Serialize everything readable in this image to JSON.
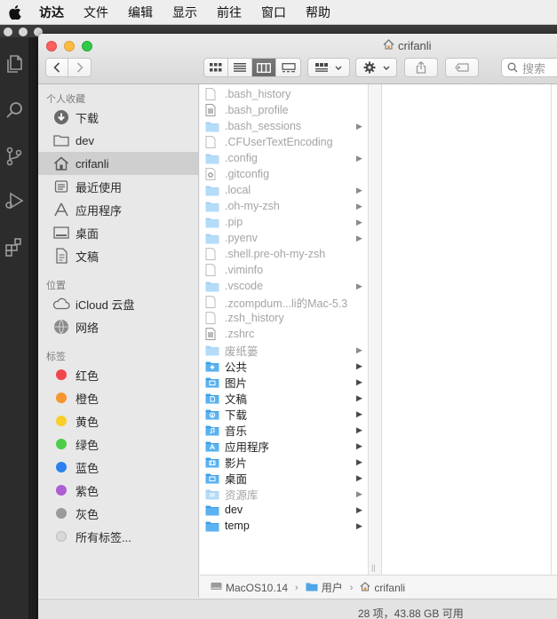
{
  "menubar": {
    "items": [
      "访达",
      "文件",
      "编辑",
      "显示",
      "前往",
      "窗口",
      "帮助"
    ]
  },
  "window": {
    "title": "crifanli"
  },
  "toolbar": {
    "search_placeholder": "搜索"
  },
  "sidebar": {
    "favorites_header": "个人收藏",
    "favorites": [
      {
        "label": "下载",
        "icon": "download-icon"
      },
      {
        "label": "dev",
        "icon": "folder-icon"
      },
      {
        "label": "crifanli",
        "icon": "home-icon",
        "selected": true
      },
      {
        "label": "最近使用",
        "icon": "recents-icon"
      },
      {
        "label": "应用程序",
        "icon": "applications-icon"
      },
      {
        "label": "桌面",
        "icon": "desktop-icon"
      },
      {
        "label": "文稿",
        "icon": "documents-icon"
      }
    ],
    "locations_header": "位置",
    "locations": [
      {
        "label": "iCloud 云盘",
        "icon": "cloud-icon"
      },
      {
        "label": "网络",
        "icon": "network-icon"
      }
    ],
    "tags_header": "标签",
    "tags": [
      {
        "label": "红色",
        "color": "#f1464b"
      },
      {
        "label": "橙色",
        "color": "#f7952e"
      },
      {
        "label": "黄色",
        "color": "#f8cf2b"
      },
      {
        "label": "绿色",
        "color": "#4ccd4a"
      },
      {
        "label": "蓝色",
        "color": "#2b82ee"
      },
      {
        "label": "紫色",
        "color": "#ae5ed3"
      },
      {
        "label": "灰色",
        "color": "#9a9a9a"
      },
      {
        "label": "所有标签...",
        "color": "#d8d8d8"
      }
    ]
  },
  "files": [
    {
      "name": ".bash_history",
      "kind": "doc",
      "hidden": true,
      "folder": false
    },
    {
      "name": ".bash_profile",
      "kind": "text",
      "hidden": true,
      "folder": false
    },
    {
      "name": ".bash_sessions",
      "kind": "folder",
      "hidden": true,
      "folder": true
    },
    {
      "name": ".CFUserTextEncoding",
      "kind": "doc",
      "hidden": true,
      "folder": false
    },
    {
      "name": ".config",
      "kind": "folder",
      "hidden": true,
      "folder": true
    },
    {
      "name": ".gitconfig",
      "kind": "gear",
      "hidden": true,
      "folder": false
    },
    {
      "name": ".local",
      "kind": "folder",
      "hidden": true,
      "folder": true
    },
    {
      "name": ".oh-my-zsh",
      "kind": "folder",
      "hidden": true,
      "folder": true
    },
    {
      "name": ".pip",
      "kind": "folder",
      "hidden": true,
      "folder": true
    },
    {
      "name": ".pyenv",
      "kind": "folder",
      "hidden": true,
      "folder": true
    },
    {
      "name": ".shell.pre-oh-my-zsh",
      "kind": "doc",
      "hidden": true,
      "folder": false
    },
    {
      "name": ".viminfo",
      "kind": "doc",
      "hidden": true,
      "folder": false
    },
    {
      "name": ".vscode",
      "kind": "folder",
      "hidden": true,
      "folder": true
    },
    {
      "name": ".zcompdum...li的Mac-5.3",
      "kind": "doc",
      "hidden": true,
      "folder": false
    },
    {
      "name": ".zsh_history",
      "kind": "doc",
      "hidden": true,
      "folder": false
    },
    {
      "name": ".zshrc",
      "kind": "text",
      "hidden": true,
      "folder": false
    },
    {
      "name": "废纸篓",
      "kind": "folder",
      "hidden": true,
      "folder": true
    },
    {
      "name": "公共",
      "kind": "folder-public",
      "hidden": false,
      "folder": true
    },
    {
      "name": "图片",
      "kind": "folder-pictures",
      "hidden": false,
      "folder": true
    },
    {
      "name": "文稿",
      "kind": "folder-documents",
      "hidden": false,
      "folder": true
    },
    {
      "name": "下载",
      "kind": "folder-downloads",
      "hidden": false,
      "folder": true
    },
    {
      "name": "音乐",
      "kind": "folder-music",
      "hidden": false,
      "folder": true
    },
    {
      "name": "应用程序",
      "kind": "folder-applications",
      "hidden": false,
      "folder": true
    },
    {
      "name": "影片",
      "kind": "folder-movies",
      "hidden": false,
      "folder": true
    },
    {
      "name": "桌面",
      "kind": "folder-desktop",
      "hidden": false,
      "folder": true
    },
    {
      "name": "资源库",
      "kind": "folder-library",
      "hidden": true,
      "folder": true
    },
    {
      "name": "dev",
      "kind": "folder",
      "hidden": false,
      "folder": true
    },
    {
      "name": "temp",
      "kind": "folder",
      "hidden": false,
      "folder": true
    }
  ],
  "pathbar": {
    "segments": [
      "MacOS10.14",
      "用户",
      "crifanli"
    ]
  },
  "status": {
    "text": "28 项，43.88 GB 可用"
  }
}
